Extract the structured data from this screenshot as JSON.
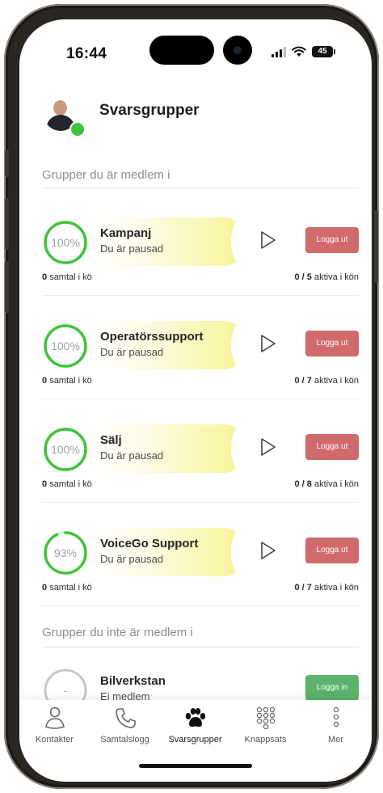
{
  "status": {
    "time": "16:44",
    "battery": "45"
  },
  "header": {
    "title": "Svarsgrupper"
  },
  "sections": {
    "member": "Grupper du är medlem i",
    "non_member": "Grupper du inte är medlem i"
  },
  "groups": [
    {
      "name": "Kampanj",
      "status": "Du är pausad",
      "percent": 100,
      "percent_label": "100%",
      "button": "Logga ut",
      "queue_count": "0",
      "queue_label": "samtal i kö",
      "active_count": "0 / 5",
      "active_label": "aktiva i kön"
    },
    {
      "name": "Operatörssupport",
      "status": "Du är pausad",
      "percent": 100,
      "percent_label": "100%",
      "button": "Logga ut",
      "queue_count": "0",
      "queue_label": "samtal i kö",
      "active_count": "0 / 7",
      "active_label": "aktiva i kön"
    },
    {
      "name": "Sälj",
      "status": "Du är pausad",
      "percent": 100,
      "percent_label": "100%",
      "button": "Logga ut",
      "queue_count": "0",
      "queue_label": "samtal i kö",
      "active_count": "0 / 8",
      "active_label": "aktiva i kön"
    },
    {
      "name": "VoiceGo Support",
      "status": "Du är pausad",
      "percent": 93,
      "percent_label": "93%",
      "button": "Logga ut",
      "queue_count": "0",
      "queue_label": "samtal i kö",
      "active_count": "0 / 7",
      "active_label": "aktiva i kön"
    }
  ],
  "other_groups": [
    {
      "name": "Bilverkstan",
      "status": "Ej medlem",
      "percent_label": "-",
      "button": "Logga in"
    }
  ],
  "tabs": [
    {
      "label": "Kontakter",
      "icon": "person-icon"
    },
    {
      "label": "Samtalslogg",
      "icon": "phone-icon"
    },
    {
      "label": "Svarsgrupper",
      "icon": "paw-icon",
      "active": true
    },
    {
      "label": "Knappsats",
      "icon": "keypad-icon"
    },
    {
      "label": "Mer",
      "icon": "more-vertical-icon"
    }
  ],
  "colors": {
    "ring_green": "#3ec43a",
    "logout_red": "#d16a6a",
    "login_green": "#5cb36b",
    "highlight_yellow": "#f6f392"
  }
}
